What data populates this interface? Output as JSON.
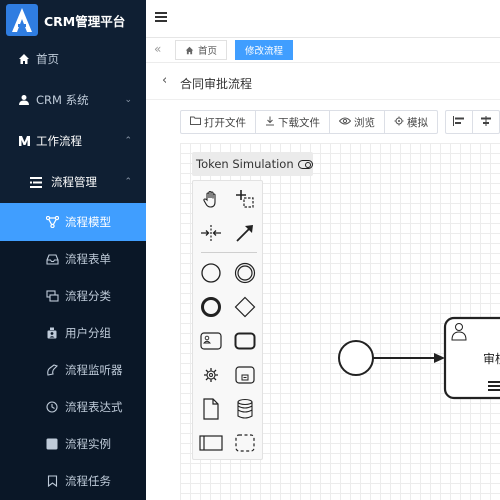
{
  "brand": {
    "logo_letter": "A",
    "title": "CRM管理平台"
  },
  "sidebar": {
    "items": [
      {
        "label": "首页",
        "icon": "home-icon"
      },
      {
        "label": "CRM 系统",
        "icon": "user-icon",
        "arrow": "chevron-down"
      },
      {
        "label": "工作流程",
        "icon": "workflow-icon",
        "arrow": "chevron-up"
      },
      {
        "label": "流程管理",
        "icon": "list-icon",
        "arrow": "chevron-up"
      },
      {
        "label": "流程模型",
        "icon": "model-icon"
      },
      {
        "label": "流程表单",
        "icon": "form-icon"
      },
      {
        "label": "流程分类",
        "icon": "category-icon"
      },
      {
        "label": "用户分组",
        "icon": "group-icon"
      },
      {
        "label": "流程监听器",
        "icon": "listener-icon"
      },
      {
        "label": "流程表达式",
        "icon": "expression-icon"
      },
      {
        "label": "流程实例",
        "icon": "instance-icon"
      },
      {
        "label": "流程任务",
        "icon": "task-icon"
      }
    ]
  },
  "tags": {
    "items": [
      {
        "label": "首页"
      },
      {
        "label": "修改流程"
      }
    ]
  },
  "page": {
    "title": "合同审批流程"
  },
  "toolbar": {
    "buttons": [
      {
        "label": "打开文件",
        "icon": "folder-icon"
      },
      {
        "label": "下载文件",
        "icon": "download-icon"
      },
      {
        "label": "浏览",
        "icon": "eye-icon"
      },
      {
        "label": "模拟",
        "icon": "cog-icon"
      }
    ]
  },
  "editor": {
    "token_simulation": "Token Simulation",
    "task_label": "审核"
  },
  "colors": {
    "sidebar_bg": "#0f1f33",
    "accent": "#409eff",
    "logo": "#2f7de1"
  }
}
